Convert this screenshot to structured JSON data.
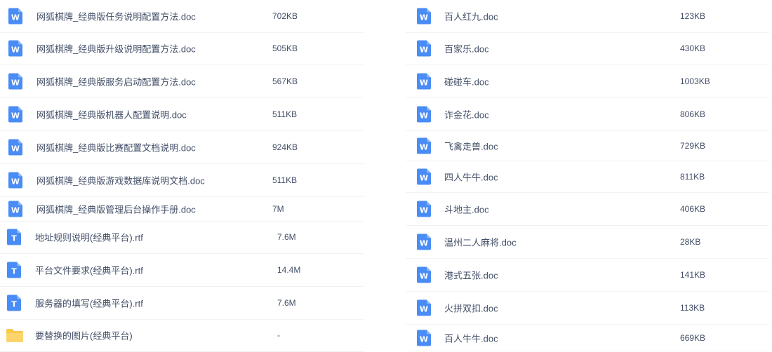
{
  "colors": {
    "word_icon": "#4a8cf5",
    "text_icon": "#4a8cf5",
    "folder_icon": "#f8c94c",
    "divider": "#f1f2f5",
    "text": "#424e67"
  },
  "left_column": [
    {
      "icon": "word-icon",
      "name": "网狐棋牌_经典版任务说明配置方法.doc",
      "size": "702KB"
    },
    {
      "icon": "word-icon",
      "name": "网狐棋牌_经典版升级说明配置方法.doc",
      "size": "505KB"
    },
    {
      "icon": "word-icon",
      "name": "网狐棋牌_经典版服务启动配置方法.doc",
      "size": "567KB"
    },
    {
      "icon": "word-icon",
      "name": "网狐棋牌_经典版机器人配置说明.doc",
      "size": "511KB"
    },
    {
      "icon": "word-icon",
      "name": "网狐棋牌_经典版比赛配置文档说明.doc",
      "size": "924KB"
    },
    {
      "icon": "word-icon",
      "name": "网狐棋牌_经典版游戏数据库说明文档.doc",
      "size": "511KB"
    },
    {
      "icon": "word-icon",
      "name": "网狐棋牌_经典版管理后台操作手册.doc",
      "size": "7M"
    },
    {
      "icon": "text-icon",
      "name": "地址规则说明(经典平台).rtf",
      "size": "7.6M"
    },
    {
      "icon": "text-icon",
      "name": "平台文件要求(经典平台).rtf",
      "size": "14.4M"
    },
    {
      "icon": "text-icon",
      "name": "服务器的填写(经典平台).rtf",
      "size": "7.6M"
    },
    {
      "icon": "folder-icon",
      "name": "要替换的图片(经典平台)",
      "size": "-"
    }
  ],
  "right_column": [
    {
      "icon": "word-icon",
      "name": "百人红九.doc",
      "size": "123KB"
    },
    {
      "icon": "word-icon",
      "name": "百家乐.doc",
      "size": "430KB"
    },
    {
      "icon": "word-icon",
      "name": "碰碰车.doc",
      "size": "1003KB"
    },
    {
      "icon": "word-icon",
      "name": "诈金花.doc",
      "size": "806KB"
    },
    {
      "icon": "word-icon",
      "name": "飞禽走兽.doc",
      "size": "729KB"
    },
    {
      "icon": "word-icon",
      "name": "四人牛牛.doc",
      "size": "811KB"
    },
    {
      "icon": "word-icon",
      "name": "斗地主.doc",
      "size": "406KB"
    },
    {
      "icon": "word-icon",
      "name": "温州二人麻将.doc",
      "size": "28KB"
    },
    {
      "icon": "word-icon",
      "name": "港式五张.doc",
      "size": "141KB"
    },
    {
      "icon": "word-icon",
      "name": "火拼双扣.doc",
      "size": "113KB"
    },
    {
      "icon": "word-icon",
      "name": "百人牛牛.doc",
      "size": "669KB"
    }
  ]
}
